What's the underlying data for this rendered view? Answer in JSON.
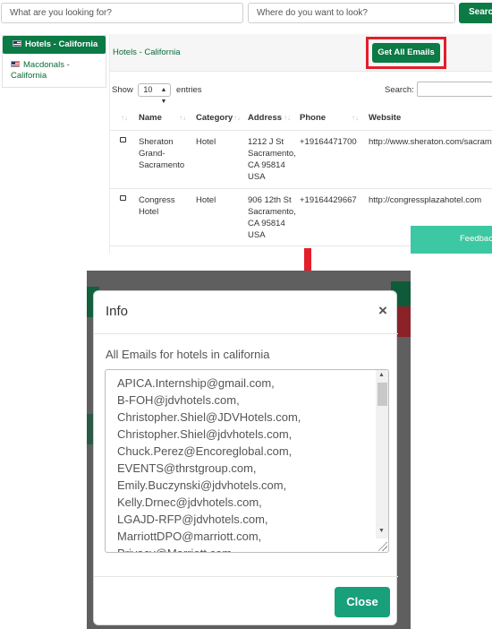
{
  "top": {
    "search": {
      "what_placeholder": "What are you looking for?",
      "where_placeholder": "Where do you want to look?",
      "button_label": "Search"
    },
    "sidebar": {
      "items": [
        {
          "label": "Hotels - California",
          "active": true
        },
        {
          "label": "Macdonals - California",
          "active": false
        }
      ]
    },
    "panel": {
      "title": "Hotels - California",
      "get_all_emails_label": "Get All Emails",
      "show_label": "Show",
      "length_value": "10",
      "entries_label": "entries",
      "search_label": "Search:",
      "columns": [
        "Name",
        "Category",
        "Address",
        "Phone",
        "Website"
      ],
      "rows": [
        {
          "name": [
            "Sheraton",
            "Grand-",
            "Sacramento"
          ],
          "category": "Hotel",
          "address": [
            "1212 J St",
            "Sacramento,",
            "CA 95814",
            "USA"
          ],
          "phone": "+19164471700",
          "website": "http://www.sheraton.com/sacramento"
        },
        {
          "name": [
            "Congress",
            "Hotel"
          ],
          "category": "Hotel",
          "address": [
            "906 12th St",
            "Sacramento,",
            "CA 95814",
            "USA"
          ],
          "phone": "+19164429667",
          "website": "http://congressplazahotel.com"
        }
      ]
    },
    "feedback_label": "Feedback"
  },
  "modal": {
    "title": "Info",
    "close_symbol": "×",
    "label": "All Emails for hotels in california",
    "emails": [
      "APICA.Internship@gmail.com,",
      "B-FOH@jdvhotels.com,",
      "Christopher.Shiel@JDVHotels.com,",
      "Christopher.Shiel@jdvhotels.com,",
      "Chuck.Perez@Encoreglobal.com,",
      "EVENTS@thrstgroup.com,",
      "Emily.Buczynski@jdvhotels.com,",
      "Kelly.Drnec@jdvhotels.com,",
      "LGAJD-RFP@jdvhotels.com,",
      "MarriottDPO@marriott.com,",
      "Privacy@Marriott.com,"
    ],
    "close_label": "Close"
  },
  "colors": {
    "brand_green": "#0b7a45",
    "highlight_red": "#e41e2a",
    "feedback_teal": "#3cc8a2",
    "close_teal": "#17a07a",
    "overlay": "#5f5f5f"
  }
}
